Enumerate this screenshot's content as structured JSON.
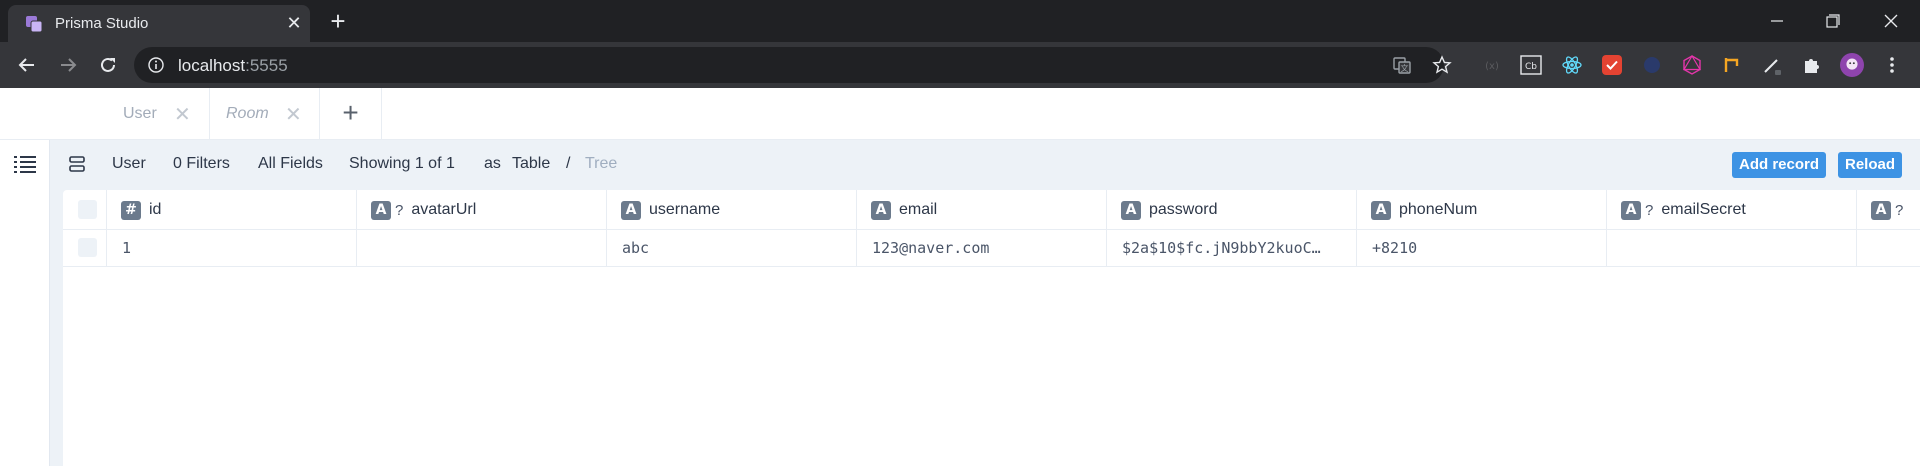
{
  "browser": {
    "tab_title": "Prisma Studio",
    "url_host": "localhost",
    "url_port": ":5555"
  },
  "app_tabs": [
    {
      "label": "User",
      "active": false
    },
    {
      "label": "Room",
      "italic": true
    }
  ],
  "controls": {
    "model": "User",
    "filters": "0 Filters",
    "fields": "All Fields",
    "showing": "Showing 1 of 1",
    "as_label": "as",
    "view_table": "Table",
    "separator": "/",
    "view_tree": "Tree",
    "add_record": "Add record",
    "reload": "Reload"
  },
  "columns": [
    {
      "badge": "#",
      "optional": "",
      "name": "id"
    },
    {
      "badge": "A",
      "optional": "?",
      "name": "avatarUrl"
    },
    {
      "badge": "A",
      "optional": "",
      "name": "username"
    },
    {
      "badge": "A",
      "optional": "",
      "name": "email"
    },
    {
      "badge": "A",
      "optional": "",
      "name": "password"
    },
    {
      "badge": "A",
      "optional": "",
      "name": "phoneNum"
    },
    {
      "badge": "A",
      "optional": "?",
      "name": "emailSecret"
    },
    {
      "badge": "A",
      "optional": "?",
      "name": ""
    }
  ],
  "rows": [
    [
      "1",
      "",
      "abc",
      "123@naver.com",
      "$2a$10$fc.jN9bbY2kuoC…",
      "+8210",
      "",
      ""
    ]
  ],
  "colors": {
    "accent": "#3d93e4",
    "badge": "#6b7a8c",
    "chrome_dark": "#202124",
    "chrome_toolbar": "#35363a"
  }
}
